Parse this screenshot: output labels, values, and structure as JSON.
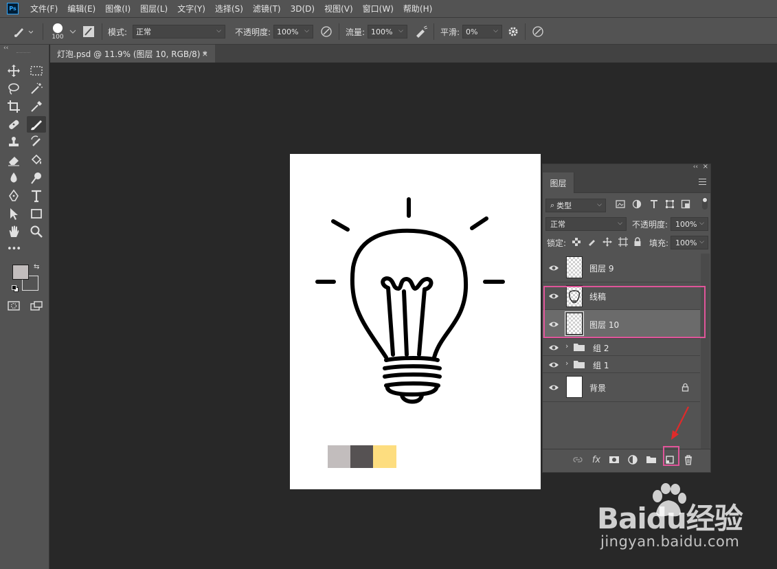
{
  "app": {
    "logo": "Ps"
  },
  "menu": [
    "文件(F)",
    "编辑(E)",
    "图像(I)",
    "图层(L)",
    "文字(Y)",
    "选择(S)",
    "滤镜(T)",
    "3D(D)",
    "视图(V)",
    "窗口(W)",
    "帮助(H)"
  ],
  "options": {
    "brush_size": "100",
    "mode_label": "模式:",
    "mode_value": "正常",
    "opacity_label": "不透明度:",
    "opacity_value": "100%",
    "flow_label": "流量:",
    "flow_value": "100%",
    "smooth_label": "平滑:",
    "smooth_value": "0%"
  },
  "document_tab": {
    "title": "灯泡.psd @ 11.9% (图层 10, RGB/8) *",
    "close": "×"
  },
  "toolbar": {
    "collapse": "‹‹",
    "more": "•••"
  },
  "swatches": [
    "#c2bdbd",
    "#565253",
    "#fddd7f"
  ],
  "layers_panel": {
    "tab": "图层",
    "filter_kind": "类型",
    "blend_mode": "正常",
    "opacity_label": "不透明度:",
    "opacity_value": "100%",
    "lock_label": "锁定:",
    "fill_label": "填充:",
    "fill_value": "100%",
    "layers": [
      {
        "name": "图层 9",
        "type": "layer",
        "selected": false
      },
      {
        "name": "线稿",
        "type": "layer",
        "selected": false
      },
      {
        "name": "图层 10",
        "type": "layer",
        "selected": true
      },
      {
        "name": "组 2",
        "type": "group",
        "selected": false
      },
      {
        "name": "组 1",
        "type": "group",
        "selected": false
      },
      {
        "name": "背景",
        "type": "background",
        "selected": false,
        "locked": true
      }
    ],
    "bottom_fx": "fx"
  },
  "annotation": {
    "highlight_color": "#e0559a",
    "arrow_color": "#e02a2a"
  },
  "watermark": {
    "brand": "Baidu经验",
    "url": "jingyan.baidu.com"
  }
}
